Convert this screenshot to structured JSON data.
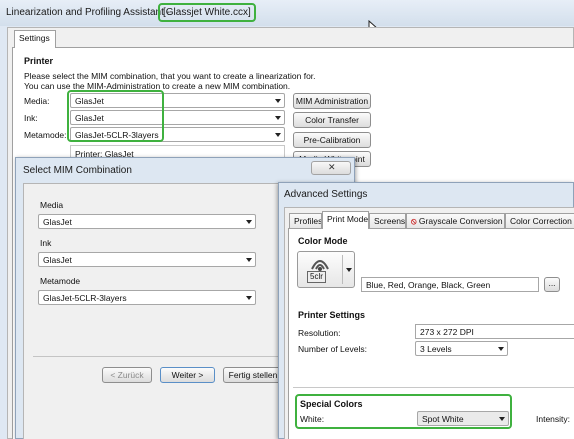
{
  "main_window": {
    "title_prefix": "Linearization and Profiling Assistant - ",
    "title_file": "[Glassjet White.ccx]",
    "tab_settings": "Settings",
    "printer_header": "Printer",
    "instruction_1": "Please select the MIM combination, that you want to create a linearization for.",
    "instruction_2": "You can use the MIM-Administration to create a new MIM combination.",
    "media_label": "Media:",
    "media_value": "GlasJet",
    "ink_label": "Ink:",
    "ink_value": "GlasJet",
    "metamode_label": "Metamode:",
    "metamode_value": "GlasJet-5CLR-3layers",
    "printer_info": "Printer: GlasJet",
    "btn_mim_admin": "MIM Administration",
    "btn_color_transfer": "Color Transfer",
    "btn_pre_calibration": "Pre-Calibration",
    "btn_media_whitepoint": "Media Whitepoint"
  },
  "select_mim": {
    "title": "Select MIM Combination",
    "media_label": "Media",
    "media_value": "GlasJet",
    "ink_label": "Ink",
    "ink_value": "GlasJet",
    "metamode_label": "Metamode",
    "metamode_value": "GlasJet-5CLR-3layers",
    "btn_back": "< Zurück",
    "btn_next": "Weiter >",
    "btn_finish": "Fertig stellen"
  },
  "advanced": {
    "title": "Advanced Settings",
    "tabs": [
      "Profiles",
      "Print Mode",
      "Screens",
      "Grayscale Conversion",
      "Color Correction"
    ],
    "color_mode_header": "Color Mode",
    "icon_label": "5clr",
    "color_mode_value": "Blue, Red, Orange, Black, Green",
    "browse_label": "...",
    "printer_settings_header": "Printer Settings",
    "resolution_label": "Resolution:",
    "resolution_value": "273 x 272 DPI",
    "levels_label": "Number of Levels:",
    "levels_value": "3 Levels",
    "special_colors_header": "Special Colors",
    "white_label": "White:",
    "white_value": "Spot White",
    "intensity_label": "Intensity:"
  },
  "colors": {
    "highlight": "#3fb13f",
    "window_bg": "#f0f0f0",
    "frame": "#c9d7e8"
  }
}
